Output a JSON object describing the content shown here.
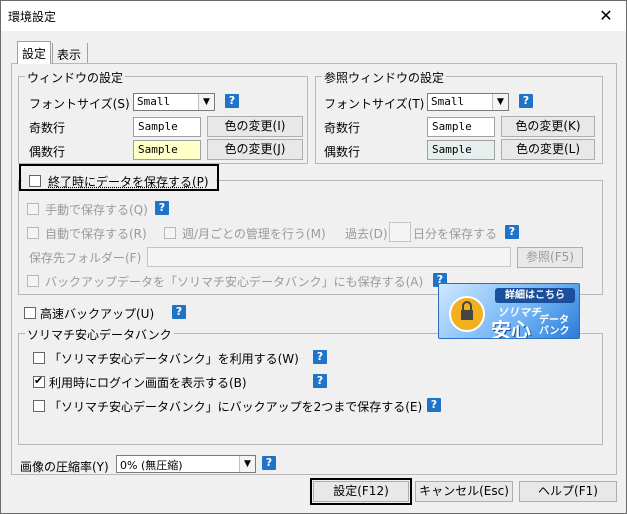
{
  "window": {
    "title": "環境設定",
    "close_glyph": "✕"
  },
  "tabs": [
    {
      "label": "設定"
    },
    {
      "label": "表示"
    }
  ],
  "window_settings": {
    "title": "ウィンドウの設定",
    "font_size_label": "フォントサイズ(S)",
    "font_size_value": "Small",
    "odd_row_label": "奇数行",
    "odd_sample": "Sample",
    "odd_color_button": "色の変更(I)",
    "even_row_label": "偶数行",
    "even_sample": "Sample",
    "even_color_button": "色の変更(J)",
    "even_sample_bg": "#ffffc8"
  },
  "ref_window_settings": {
    "title": "参照ウィンドウの設定",
    "font_size_label": "フォントサイズ(T)",
    "font_size_value": "Small",
    "odd_row_label": "奇数行",
    "odd_sample": "Sample",
    "odd_color_button": "色の変更(K)",
    "even_row_label": "偶数行",
    "even_sample": "Sample",
    "even_color_button": "色の変更(L)",
    "even_sample_bg": "#e6eeee"
  },
  "save_on_exit": {
    "label": "終了時にデータを保存する(P)",
    "checked": false,
    "manual_save": "手動で保存する(Q)",
    "auto_save": "自動で保存する(R)",
    "weekly_monthly": "週/月ごとの管理を行う(M)",
    "past_label": "過去(D)",
    "days_label": "日分を保存する",
    "folder_label": "保存先フォルダー(F)",
    "browse_button": "参照(F5)",
    "backup_bank": "バックアップデータを「ソリマチ安心データバンク」にも保存する(A)"
  },
  "fast_backup": {
    "label": "高速バックアップ(U)",
    "checked": false
  },
  "data_bank": {
    "title": "ソリマチ安心データバンク",
    "use_label": "「ソリマチ安心データバンク」を利用する(W)",
    "use_checked": false,
    "login_label": "利用時にログイン画面を表示する(B)",
    "login_checked": true,
    "backup2_label": "「ソリマチ安心データバンク」にバックアップを2つまで保存する(E)",
    "backup2_checked": false,
    "banner": {
      "pill": "詳細はこちら",
      "line1": "ソリマチ",
      "line2": "安心",
      "line3a": "データ",
      "line3b": "バンク"
    }
  },
  "compression": {
    "label": "画像の圧縮率(Y)",
    "value": "0%  (無圧縮)"
  },
  "footer": {
    "ok_button": "設定(F12)",
    "cancel_button": "キャンセル(Esc)",
    "help_button": "ヘルプ(F1)"
  },
  "help_glyph": "?",
  "combo_arrow": "▼"
}
